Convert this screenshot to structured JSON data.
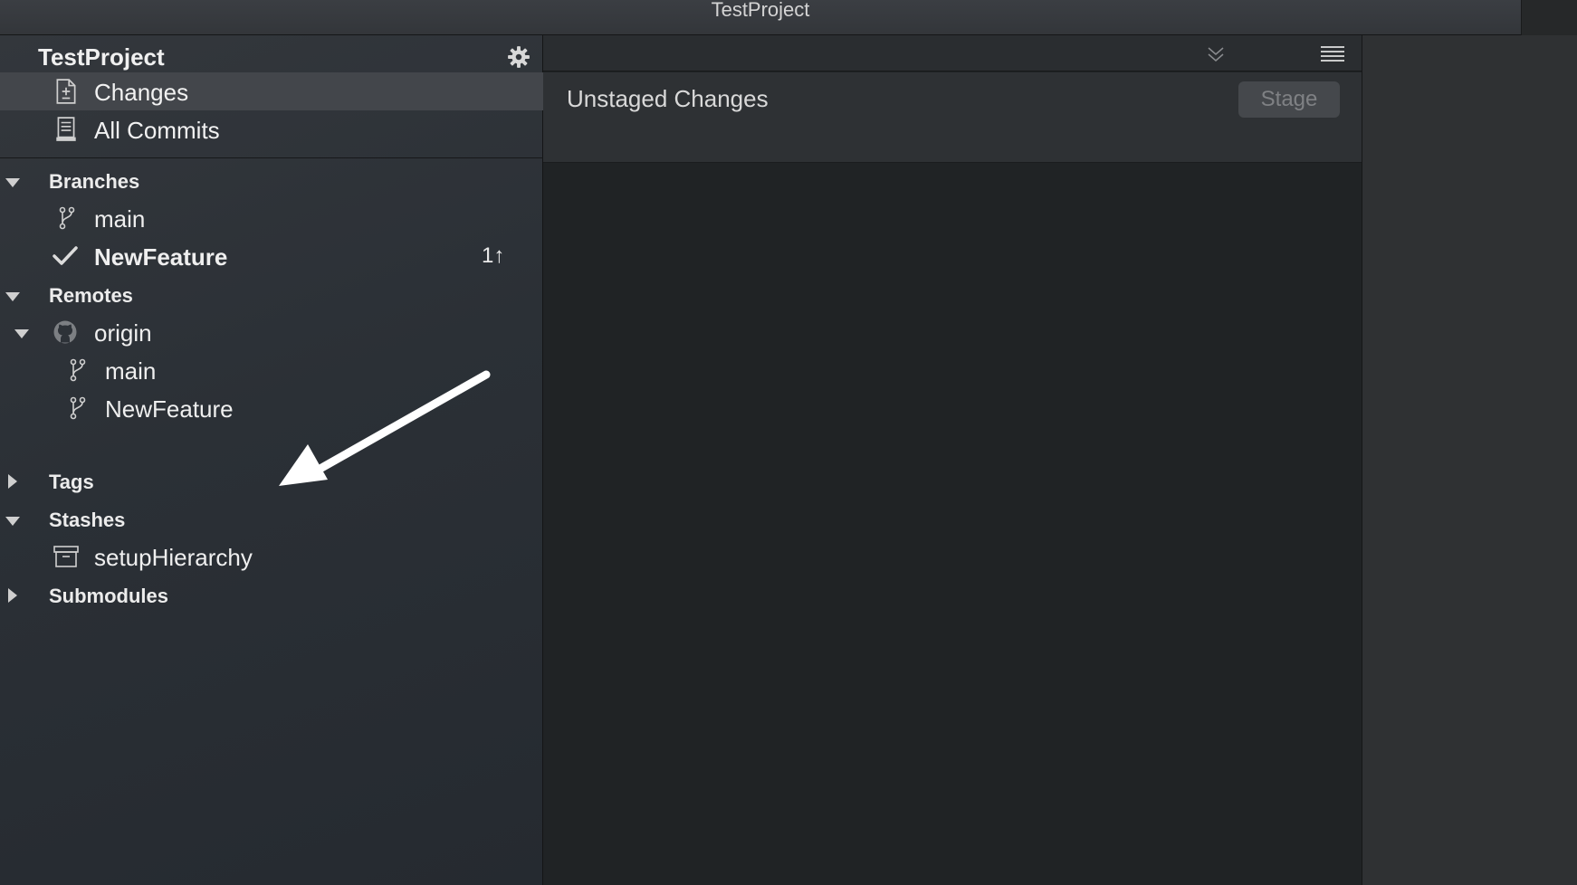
{
  "window": {
    "title": "TestProject"
  },
  "sidebar": {
    "repo_name": "TestProject",
    "settings_icon": "gear-icon",
    "nav": [
      {
        "label": "Changes",
        "icon": "changes-document-icon",
        "selected": true
      },
      {
        "label": "All Commits",
        "icon": "commits-history-icon",
        "selected": false
      }
    ],
    "branches": {
      "label": "Branches",
      "items": [
        {
          "label": "main",
          "icon": "branch-icon"
        },
        {
          "label": "NewFeature",
          "icon": "checkmark-icon",
          "current": true,
          "ahead": "1↑"
        }
      ]
    },
    "remotes": {
      "label": "Remotes",
      "origin": {
        "label": "origin",
        "icon": "github-icon",
        "branches": [
          {
            "label": "main"
          },
          {
            "label": "NewFeature"
          }
        ]
      }
    },
    "tags": {
      "label": "Tags",
      "expanded": false
    },
    "stashes": {
      "label": "Stashes",
      "items": [
        {
          "label": "setupHierarchy",
          "icon": "archive-box-icon"
        }
      ]
    },
    "submodules": {
      "label": "Submodules",
      "expanded": false
    }
  },
  "main": {
    "header_title": "Unstaged Changes",
    "stage_button": "Stage",
    "toolbar_icons": [
      "chevron-down-icon",
      "menu-lines-icon"
    ]
  },
  "colors": {
    "sidebar_bg": "#2b3036",
    "selected_row": "#43464b",
    "main_bg": "#202325",
    "annotation_arrow": "#ffffff"
  }
}
